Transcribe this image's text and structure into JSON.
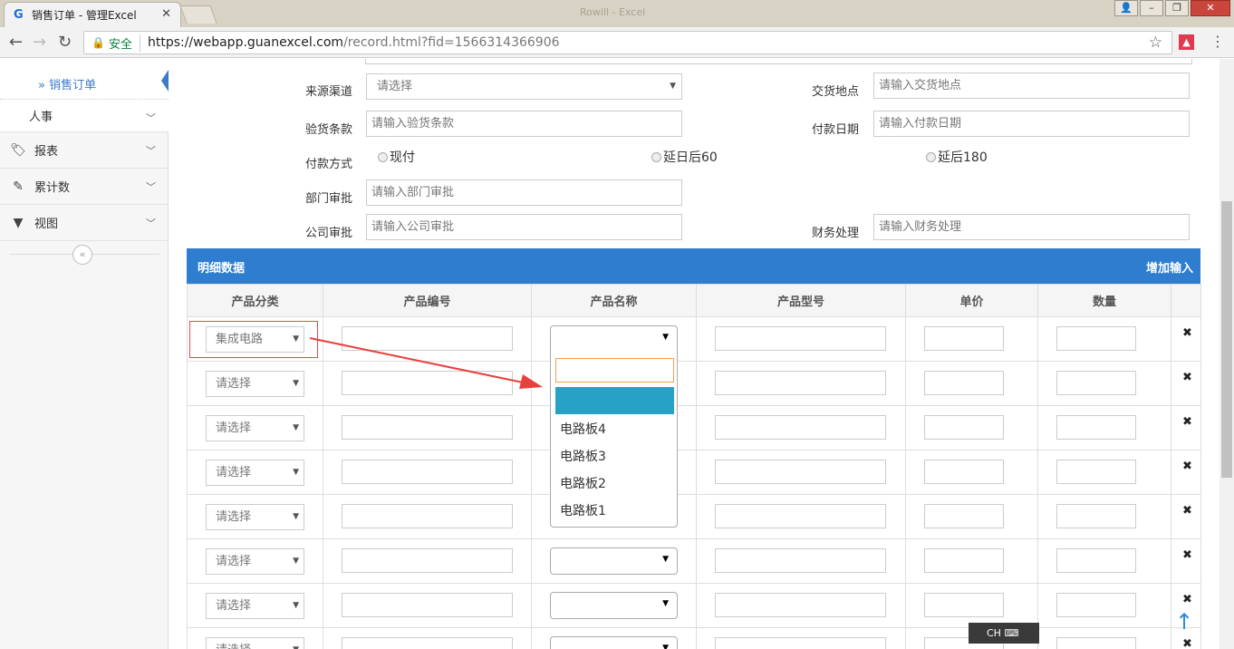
{
  "browser": {
    "tab_title": "销售订单 - 管理Excel",
    "tab_icon_glyph": "G",
    "window_title": "Rowill - Excel",
    "secure_label": "安全",
    "url_host": "https://webapp.guanexcel.com",
    "url_path": "/record.html?fid=1566314366906"
  },
  "sidebar": {
    "active_sub": "销售订单",
    "items": [
      {
        "label": "人事",
        "icon": "none"
      },
      {
        "label": "报表",
        "icon": "tag-icon"
      },
      {
        "label": "累计数",
        "icon": "edit-icon"
      },
      {
        "label": "视图",
        "icon": "filter-icon"
      }
    ]
  },
  "form": {
    "source_channel": {
      "label": "来源渠道",
      "value": "请选择"
    },
    "delivery_place": {
      "label": "交货地点",
      "placeholder": "请输入交货地点"
    },
    "inspection_terms": {
      "label": "验货条款",
      "placeholder": "请输入验货条款"
    },
    "payment_date": {
      "label": "付款日期",
      "placeholder": "请输入付款日期"
    },
    "payment_method": {
      "label": "付款方式",
      "options": [
        "现付",
        "延日后60",
        "延后180"
      ]
    },
    "dept_approval": {
      "label": "部门审批",
      "placeholder": "请输入部门审批"
    },
    "company_approval": {
      "label": "公司审批",
      "placeholder": "请输入公司审批"
    },
    "finance": {
      "label": "财务处理",
      "placeholder": "请输入财务处理"
    }
  },
  "detail": {
    "title": "明细数据",
    "add_label": "增加输入",
    "columns": [
      "产品分类",
      "产品编号",
      "产品名称",
      "产品型号",
      "单价",
      "数量"
    ],
    "rows": [
      {
        "category": "集成电路"
      },
      {
        "category": "请选择"
      },
      {
        "category": "请选择"
      },
      {
        "category": "请选择"
      },
      {
        "category": "请选择"
      },
      {
        "category": "请选择"
      },
      {
        "category": "请选择"
      },
      {
        "category": "请选择"
      }
    ],
    "delete_glyph": "✖"
  },
  "dropdown": {
    "options": [
      "电路板4",
      "电路板3",
      "电路板2",
      "电路板1"
    ]
  },
  "ime": {
    "label": "CH"
  }
}
